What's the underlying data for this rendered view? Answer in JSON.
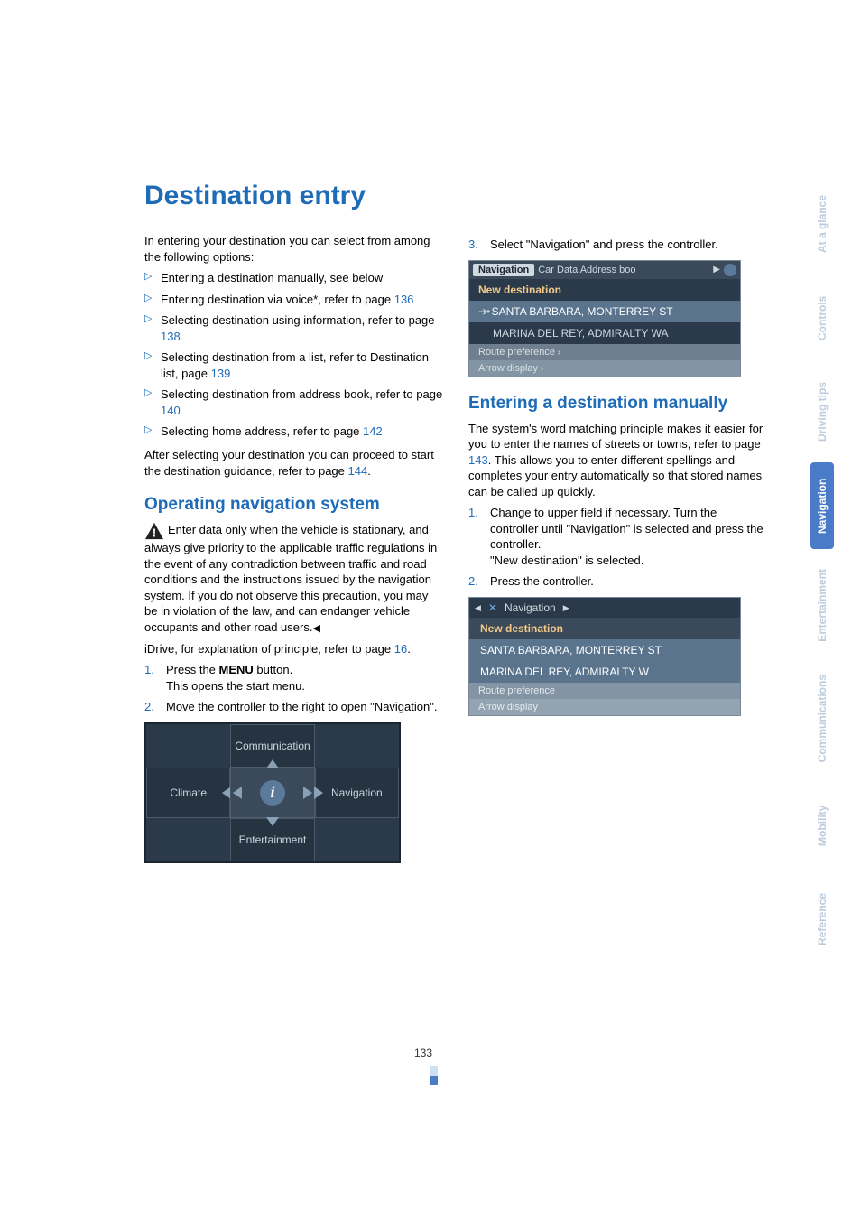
{
  "page_number": "133",
  "title": "Destination entry",
  "side_tabs": {
    "at_a_glance": "At a glance",
    "controls": "Controls",
    "driving_tips": "Driving tips",
    "navigation": "Navigation",
    "entertainment": "Entertainment",
    "communications": "Communications",
    "mobility": "Mobility",
    "reference": "Reference"
  },
  "left": {
    "intro": "In entering your destination you can select from among the following options:",
    "bullets": {
      "b1a": "Entering a destination manually, see below",
      "b2a": "Entering destination via voice*, refer to page ",
      "b2b": "136",
      "b3a": "Selecting destination using information, refer to page ",
      "b3b": "138",
      "b4a": "Selecting destination from a list, refer to Destination list, page ",
      "b4b": "139",
      "b5a": "Selecting destination from address book, refer to page ",
      "b5b": "140",
      "b6a": "Selecting home address, refer to page ",
      "b6b": "142"
    },
    "after_select_a": "After selecting your destination you can proceed to start the destination guidance, refer to page ",
    "after_select_b": "144",
    "after_select_c": ".",
    "section_operating": "Operating navigation system",
    "warn_para": "Enter data only when the vehicle is stationary, and always give priority to the applicable traffic regulations in the event of any contradiction between traffic and road conditions and the instructions issued by the navigation system. If you do not observe this precaution, you may be in violation of the law, and can endanger vehicle occupants and other road users.",
    "end_mark": "◀",
    "idrive_a": "iDrive, for explanation of principle, refer to page ",
    "idrive_b": "16",
    "idrive_c": ".",
    "step1_num": "1.",
    "step1a": "Press the ",
    "step1b": "MENU",
    "step1c": " button.",
    "step1d": "This opens the start menu.",
    "step2_num": "2.",
    "step2": "Move the controller to the right to open \"Navigation\".",
    "menu": {
      "communication": "Communication",
      "climate": "Climate",
      "navigation": "Navigation",
      "entertainment": "Entertainment"
    }
  },
  "right": {
    "step3_num": "3.",
    "step3": "Select \"Navigation\" and press the controller.",
    "screen1": {
      "tab_nav": "Navigation",
      "tab_rest": "Car Data  Address boo",
      "new_dest": "New destination",
      "row1": "SANTA BARBARA, MONTERREY ST",
      "row2": "MARINA DEL REY, ADMIRALTY WA",
      "route_pref": "Route preference",
      "arrow_disp": "Arrow display"
    },
    "section_manual": "Entering a destination manually",
    "manual_para_a": "The system's word matching principle makes it easier for you to enter the names of streets or towns, refer to page ",
    "manual_para_b": "143",
    "manual_para_c": ". This allows you to enter different spellings and completes your entry automatically so that stored names can be called up quickly.",
    "mstep1_num": "1.",
    "mstep1a": "Change to upper field if necessary. Turn the controller until \"Navigation\" is selected and press the controller.",
    "mstep1b": "\"New destination\" is selected.",
    "mstep2_num": "2.",
    "mstep2": "Press the controller.",
    "screen2": {
      "header": "Navigation",
      "new_dest": "New destination",
      "row1": "SANTA BARBARA, MONTERREY ST",
      "row2": "MARINA DEL REY, ADMIRALTY W",
      "route_pref": "Route preference",
      "arrow_disp": "Arrow display"
    }
  }
}
